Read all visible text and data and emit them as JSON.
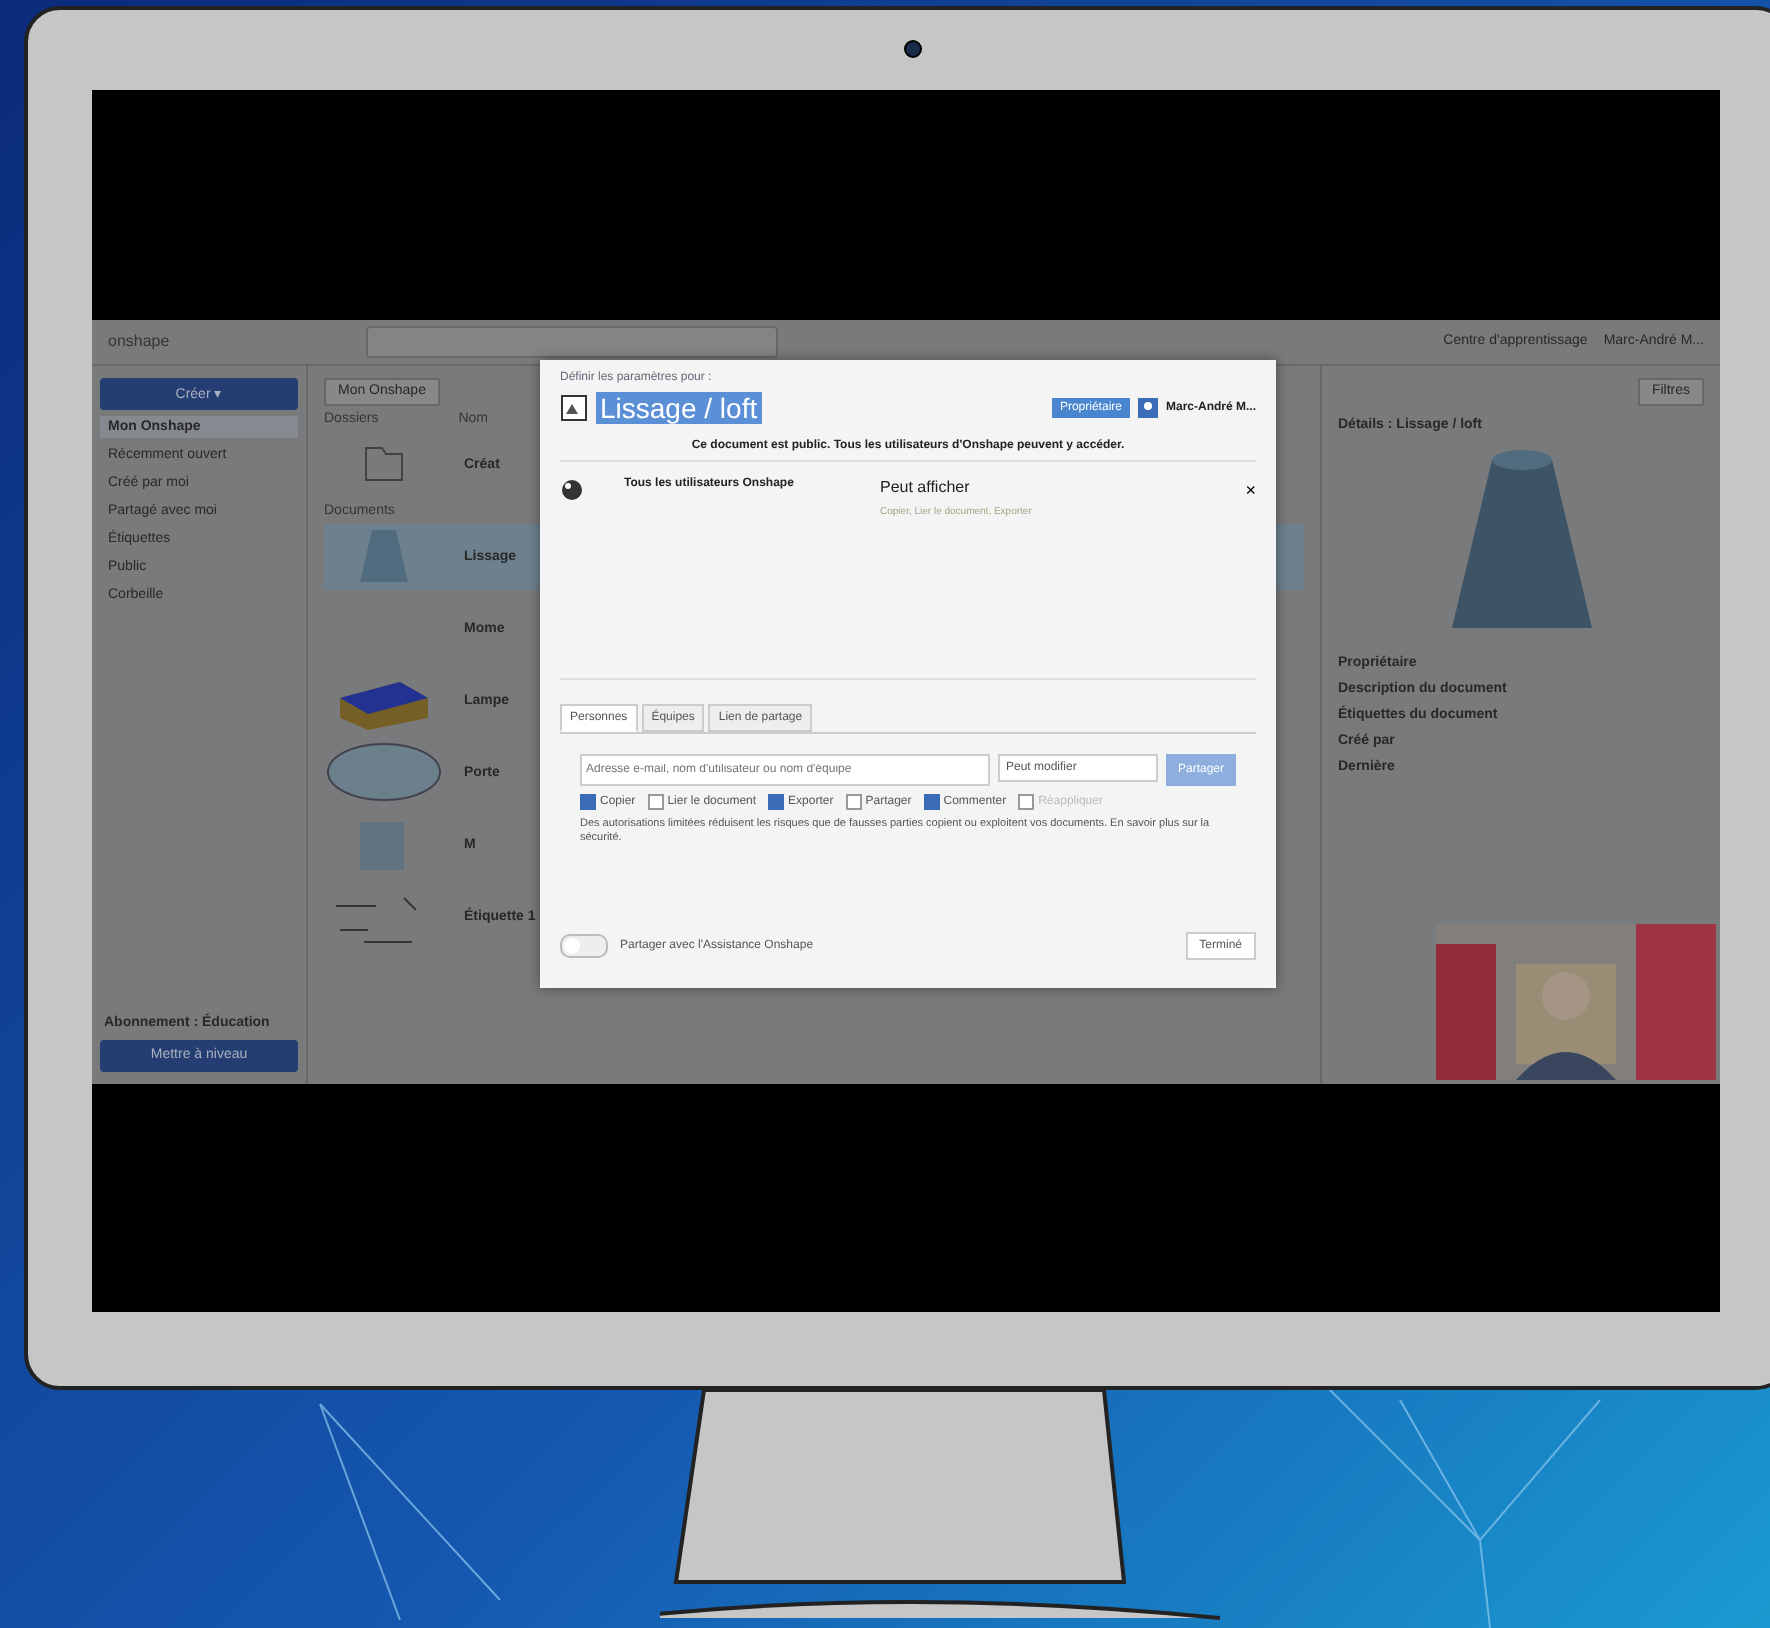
{
  "topbar": {
    "logo": "onshape",
    "help": "Centre d'apprentissage",
    "user": "Marc-André M..."
  },
  "sidebar": {
    "create": "Créer ▾",
    "items": [
      {
        "label": "Mon Onshape",
        "selected": true
      },
      {
        "label": "Récemment ouvert",
        "selected": false
      },
      {
        "label": "Créé par moi",
        "selected": false
      },
      {
        "label": "Partagé avec moi",
        "selected": false
      },
      {
        "label": "Étiquettes",
        "selected": false
      },
      {
        "label": "Public",
        "selected": false
      },
      {
        "label": "Corbeille",
        "selected": false
      }
    ],
    "plan": "Abonnement : Éducation",
    "upgrade": "Mettre à niveau"
  },
  "main": {
    "title": "Mon Onshape",
    "column": "Nom",
    "folders_label": "Dossiers",
    "documents_label": "Documents",
    "filters": "Filtres",
    "rows": [
      {
        "name": "Créat",
        "kind": "folder",
        "selected": false
      },
      {
        "name": "Lissage",
        "kind": "cone",
        "selected": true
      },
      {
        "name": "Mome",
        "kind": "none",
        "selected": false
      },
      {
        "name": "Lampe",
        "kind": "box",
        "selected": false
      },
      {
        "name": "Porte",
        "kind": "disc",
        "selected": false
      },
      {
        "name": "M",
        "kind": "cube",
        "selected": false
      },
      {
        "name": "Étiquette 1",
        "kind": "sketch",
        "selected": false
      }
    ]
  },
  "details": {
    "title": "Détails : Lissage / loft",
    "sections": [
      "Propriétaire",
      "Description du document",
      "Étiquettes du document",
      "Créé par",
      "Dernière"
    ]
  },
  "dialog": {
    "subtitle": "Définir les paramètres pour :",
    "title": "Lissage / loft",
    "close": "×",
    "owner_badge": "Propriétaire",
    "owner": "Marc-André M...",
    "notice": "Ce document est public. Tous les utilisateurs d'Onshape peuvent y accéder.",
    "entry": {
      "who": "Tous les utilisateurs Onshape",
      "permission": "Peut afficher",
      "details": "Copier, Lier le document, Exporter"
    },
    "tabs": [
      {
        "label": "Personnes",
        "selected": true
      },
      {
        "label": "Équipes",
        "selected": false
      },
      {
        "label": "Lien de partage",
        "selected": false
      }
    ],
    "invite_placeholder": "Adresse e-mail, nom d'utilisateur ou nom d'équipe",
    "role": "Peut modifier",
    "share": "Partager",
    "permissions": [
      {
        "label": "Copier",
        "checked": true,
        "disabled": false
      },
      {
        "label": "Lier le document",
        "checked": false,
        "disabled": false
      },
      {
        "label": "Exporter",
        "checked": true,
        "disabled": false
      },
      {
        "label": "Partager",
        "checked": false,
        "disabled": false
      },
      {
        "label": "Commenter",
        "checked": true,
        "disabled": false
      },
      {
        "label": "Réappliquer",
        "checked": false,
        "disabled": true
      }
    ],
    "note": "Des autorisations limitées réduisent les risques que de fausses parties copient ou exploitent vos documents. En savoir plus sur la sécurité.",
    "support": {
      "label": "Partager avec l'Assistance Onshape",
      "on": false
    },
    "done": "Terminé"
  }
}
